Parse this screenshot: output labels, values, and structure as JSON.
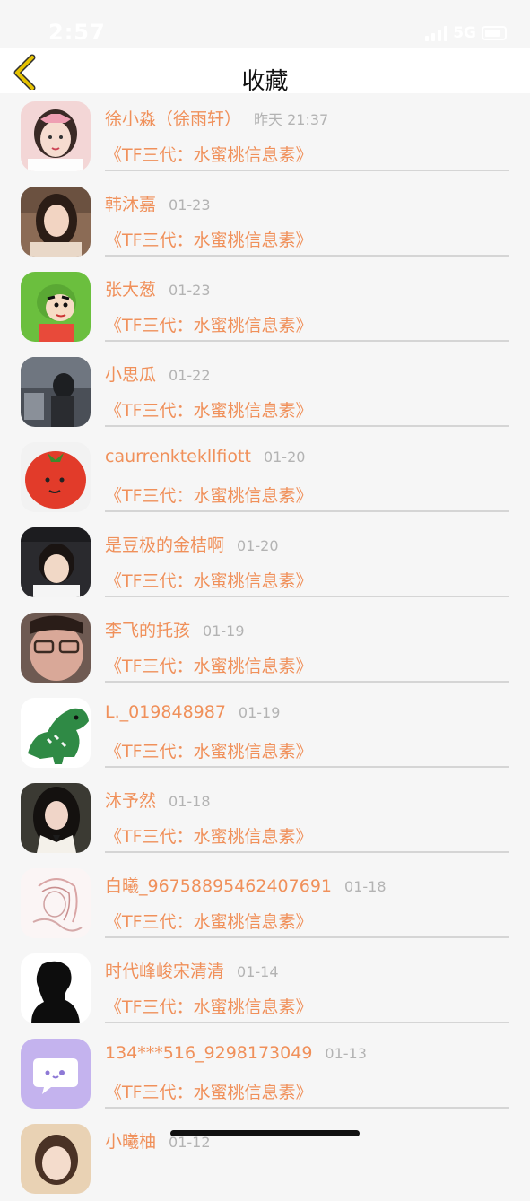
{
  "status_bar": {
    "time": "2:57",
    "network": "5G"
  },
  "header": {
    "title": "收藏"
  },
  "items": [
    {
      "name": "徐小淼（徐雨轩）",
      "date": "昨天 21:37",
      "work": "《TF三代：水蜜桃信息素》",
      "avatar": "girl-portrait-avatar"
    },
    {
      "name": "韩沐嘉",
      "date": "01-23",
      "work": "《TF三代：水蜜桃信息素》",
      "avatar": "girl-portrait-avatar"
    },
    {
      "name": "张大葱",
      "date": "01-23",
      "work": "《TF三代：水蜜桃信息素》",
      "avatar": "cartoon-avatar"
    },
    {
      "name": "小思瓜",
      "date": "01-22",
      "work": "《TF三代：水蜜桃信息素》",
      "avatar": "photo-avatar"
    },
    {
      "name": "caurrenktekllfiott",
      "date": "01-20",
      "work": "《TF三代：水蜜桃信息素》",
      "avatar": "tomato-avatar"
    },
    {
      "name": "是豆极的金桔啊",
      "date": "01-20",
      "work": "《TF三代：水蜜桃信息素》",
      "avatar": "boy-portrait-avatar"
    },
    {
      "name": "李飞的托孩",
      "date": "01-19",
      "work": "《TF三代：水蜜桃信息素》",
      "avatar": "face-closeup-avatar"
    },
    {
      "name": "L._019848987",
      "date": "01-19",
      "work": "《TF三代：水蜜桃信息素》",
      "avatar": "dinosaur-avatar"
    },
    {
      "name": "沐予然",
      "date": "01-18",
      "work": "《TF三代：水蜜桃信息素》",
      "avatar": "girl-portrait-avatar"
    },
    {
      "name": "白曦_96758895462407691",
      "date": "01-18",
      "work": "《TF三代：水蜜桃信息素》",
      "avatar": "sketch-avatar"
    },
    {
      "name": "时代峰峻宋清清",
      "date": "01-14",
      "work": "《TF三代：水蜜桃信息素》",
      "avatar": "silhouette-avatar"
    },
    {
      "name": "134***516_9298173049",
      "date": "01-13",
      "work": "《TF三代：水蜜桃信息素》",
      "avatar": "chat-bubble-avatar"
    },
    {
      "name": "小曦柚",
      "date": "01-12",
      "work": "",
      "avatar": "girl-portrait-avatar"
    }
  ],
  "colors": {
    "accent": "#f0905a",
    "back_icon": "#e6c200",
    "divider": "#d5d5d5"
  }
}
